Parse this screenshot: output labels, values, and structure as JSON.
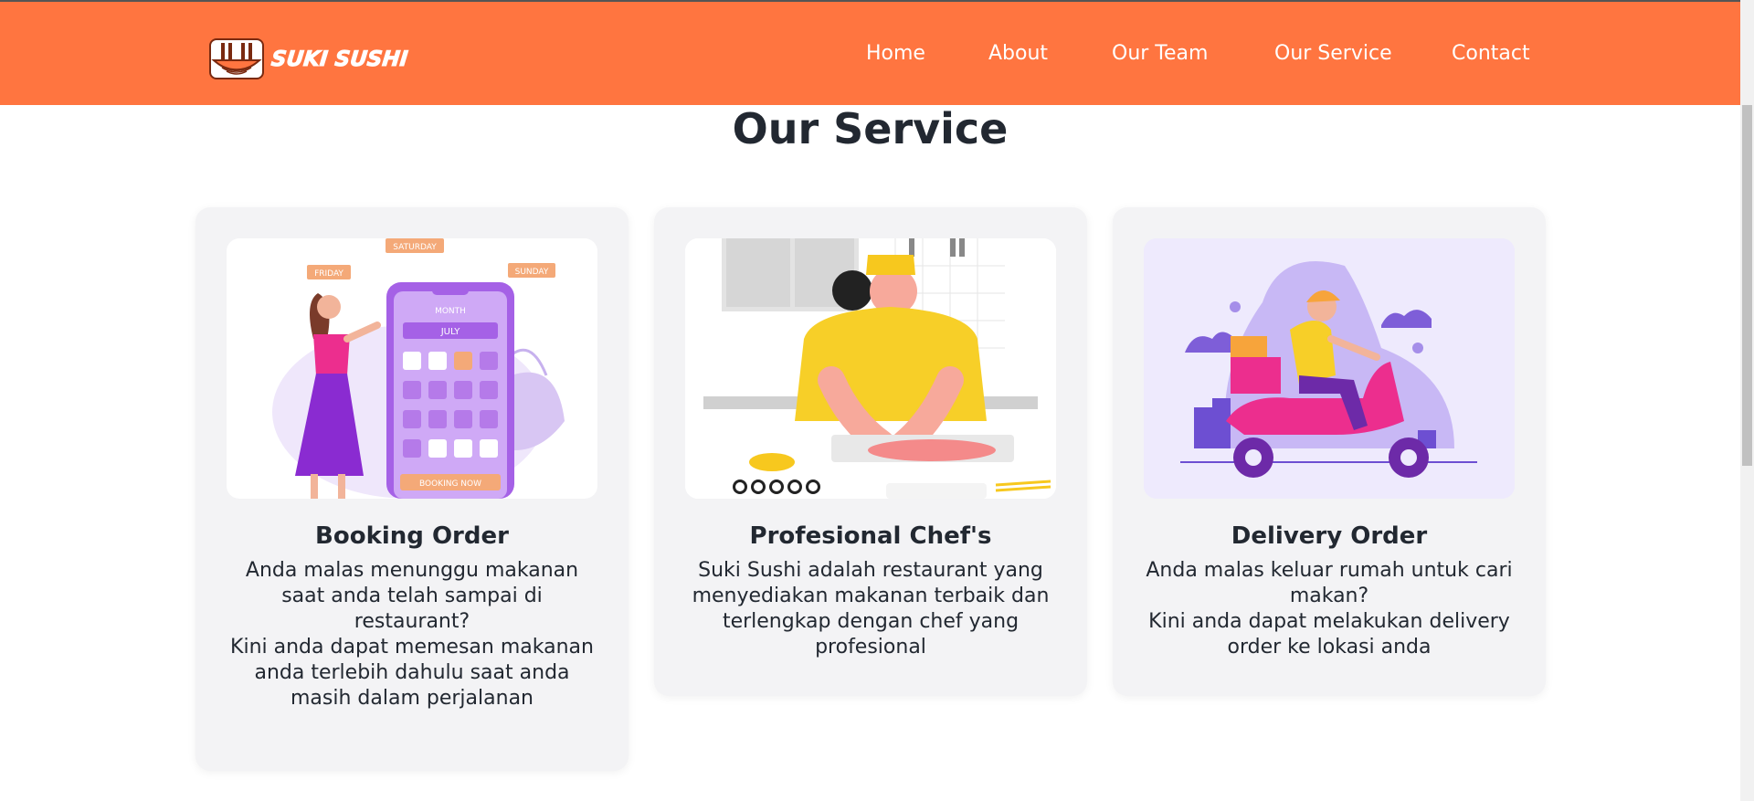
{
  "brand": {
    "name": "SUKI SUSHI",
    "color": "#ff7540"
  },
  "nav": {
    "items": [
      {
        "label": "Home"
      },
      {
        "label": "About"
      },
      {
        "label": "Our Team"
      },
      {
        "label": "Our Service"
      },
      {
        "label": "Contact"
      }
    ]
  },
  "main": {
    "title": "Our Service",
    "cards": [
      {
        "title": "Booking Order",
        "paragraphs": [
          "Anda malas menunggu makanan saat anda telah sampai di restaurant?",
          "Kini anda dapat memesan makanan anda terlebih dahulu saat anda masih dalam perjalanan"
        ],
        "illustration": {
          "icon": "booking-calendar-illustration",
          "labels": {
            "friday": "FRIDAY",
            "saturday": "SATURDAY",
            "sunday": "SUNDAY",
            "month": "MONTH",
            "july": "JULY",
            "booking": "BOOKING NOW"
          }
        }
      },
      {
        "title": "Profesional Chef's",
        "paragraphs": [
          "Suki Sushi adalah restaurant yang menyediakan makanan terbaik dan terlengkap dengan chef yang profesional"
        ],
        "illustration": {
          "icon": "chef-cutting-fish-illustration"
        }
      },
      {
        "title": "Delivery Order",
        "paragraphs": [
          "Anda malas keluar rumah untuk cari makan?",
          "Kini anda dapat melakukan delivery order ke lokasi anda"
        ],
        "illustration": {
          "icon": "scooter-delivery-illustration"
        }
      }
    ]
  }
}
